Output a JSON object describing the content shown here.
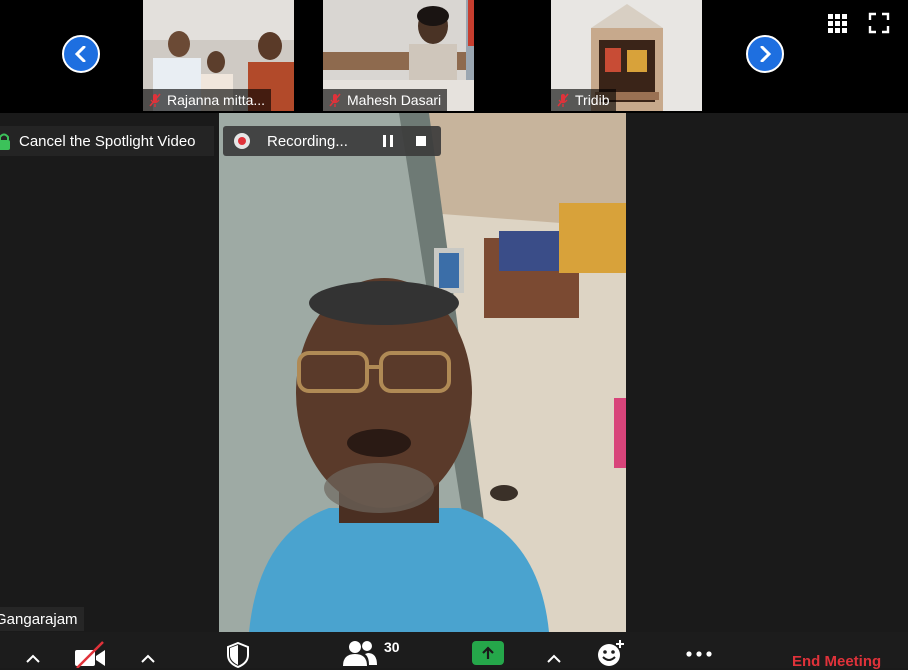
{
  "gallery": {
    "participants": [
      {
        "name": "Rajanna mitta..."
      },
      {
        "name": "Mahesh Dasari"
      },
      {
        "name": "Tridib"
      }
    ]
  },
  "spotlight": {
    "cancel_label": "Cancel the Spotlight Video"
  },
  "recording": {
    "status": "Recording..."
  },
  "speaker": {
    "name": "Gangarajam"
  },
  "toolbar": {
    "participant_count": "30",
    "end_label": "End Meeting"
  },
  "colors": {
    "accent_blue": "#1e6fe0",
    "end_red": "#e0323a",
    "share_green": "#25a74a"
  }
}
